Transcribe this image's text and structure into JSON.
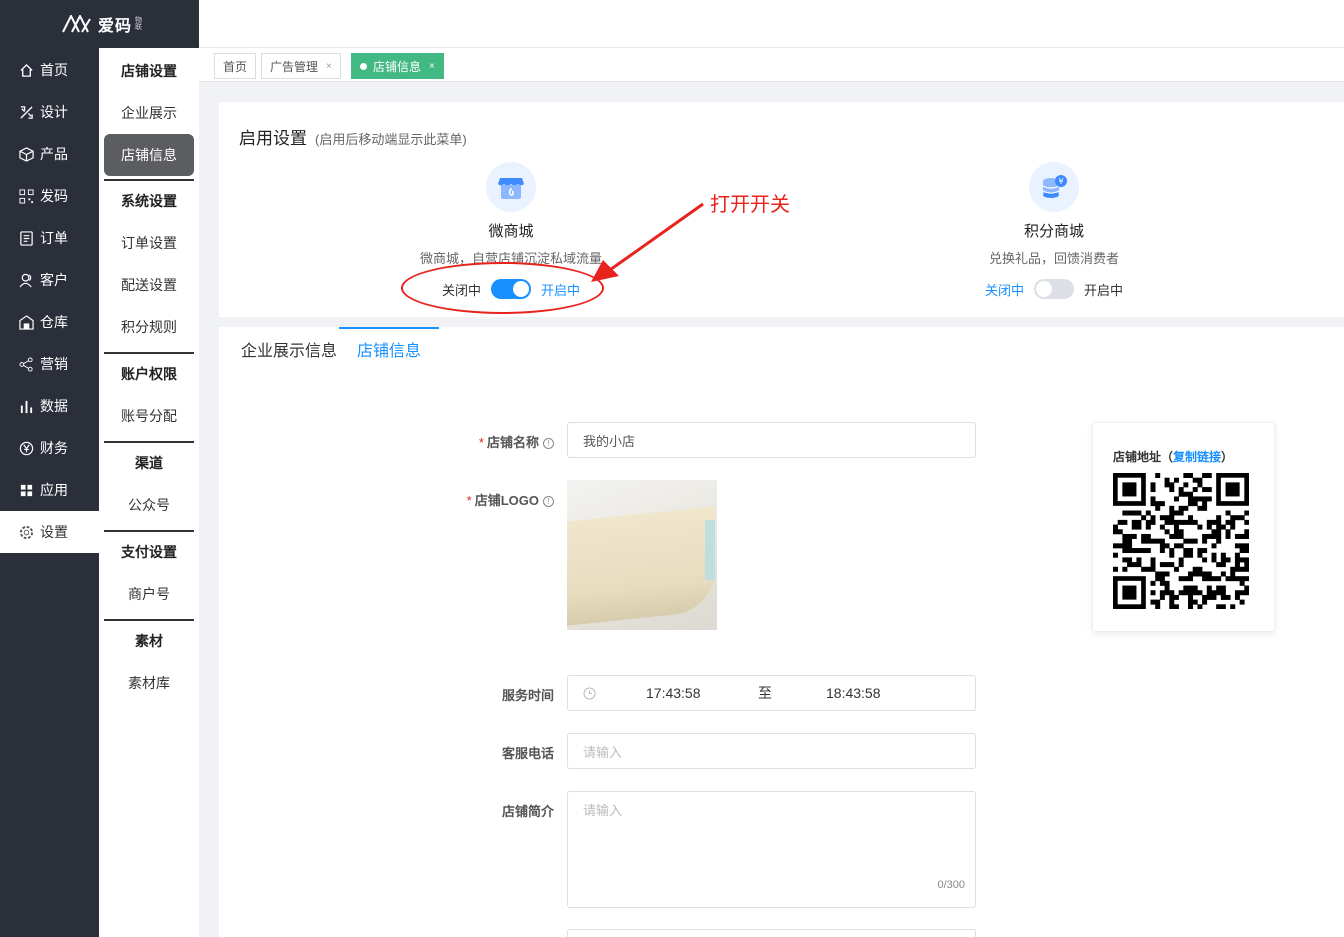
{
  "app": {
    "logo_text": "爱码",
    "logo_sub": "物联"
  },
  "nav": [
    {
      "label": "首页",
      "icon": "home-icon"
    },
    {
      "label": "设计",
      "icon": "design-icon"
    },
    {
      "label": "产品",
      "icon": "box-icon"
    },
    {
      "label": "发码",
      "icon": "qrcode-icon"
    },
    {
      "label": "订单",
      "icon": "order-icon"
    },
    {
      "label": "客户",
      "icon": "user-icon"
    },
    {
      "label": "仓库",
      "icon": "warehouse-icon"
    },
    {
      "label": "营销",
      "icon": "share-icon"
    },
    {
      "label": "数据",
      "icon": "bar-chart-icon"
    },
    {
      "label": "财务",
      "icon": "yen-icon"
    },
    {
      "label": "应用",
      "icon": "grid-icon"
    },
    {
      "label": "设置",
      "icon": "gear-icon"
    }
  ],
  "subnav": {
    "g1": "店铺设置",
    "i1": "企业展示",
    "i2": "店铺信息",
    "g2": "系统设置",
    "i3": "订单设置",
    "i4": "配送设置",
    "i5": "积分规则",
    "g3": "账户权限",
    "i6": "账号分配",
    "g4": "渠道",
    "i7": "公众号",
    "g5": "支付设置",
    "i8": "商户号",
    "g6": "素材",
    "i9": "素材库"
  },
  "tabs": {
    "t1": "首页",
    "t2": "广告管理",
    "t3": "店铺信息",
    "close": "×"
  },
  "enable": {
    "title": "启用设置",
    "subtitle": "(启用后移动端显示此菜单)",
    "f1_name": "微商城",
    "f1_desc": "微商城，自营店铺沉淀私域流量",
    "f2_name": "积分商城",
    "f2_desc": "兑换礼品，回馈消费者",
    "off": "关闭中",
    "on": "开启中"
  },
  "annotation": {
    "text": "打开开关"
  },
  "content_tabs": {
    "t1": "企业展示信息",
    "t2": "店铺信息"
  },
  "form": {
    "name_label": "店铺名称",
    "name_value": "我的小店",
    "logo_label": "店铺LOGO",
    "time_label": "服务时间",
    "time_start": "17:43:58",
    "time_sep": "至",
    "time_end": "18:43:58",
    "phone_label": "客服电话",
    "phone_placeholder": "请输入",
    "intro_label": "店铺简介",
    "intro_placeholder": "请输入",
    "intro_counter": "0/300"
  },
  "qr": {
    "title": "店铺地址",
    "paren_open": "（",
    "link": "复制链接",
    "paren_close": "）"
  },
  "colors": {
    "primary": "#1890ff",
    "dark": "#2b2f3a",
    "green": "#42b983",
    "annotation": "#e8231d"
  }
}
